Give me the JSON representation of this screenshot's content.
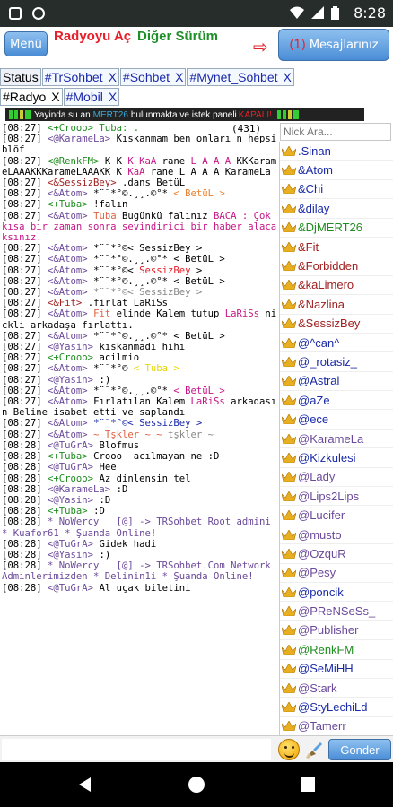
{
  "status_bar": {
    "time": "8:28"
  },
  "header": {
    "menu_label": "Menü",
    "radyo_label": "Radyoyu Aç",
    "diger_label": "Diğer Sürüm",
    "arrow": "⇨",
    "messages_count": "(1)",
    "messages_label": "Mesajlarınız"
  },
  "tabs_row1": [
    {
      "label": "Status",
      "close": "",
      "kind": "status"
    },
    {
      "label": "#TrSohbet",
      "close": "X",
      "kind": "tab"
    },
    {
      "label": "#Sohbet",
      "close": "X",
      "kind": "tab"
    },
    {
      "label": "#Mynet_Sohbet",
      "close": "X",
      "kind": "tab"
    }
  ],
  "tabs_row2": [
    {
      "label": "#Radyo",
      "close": "X",
      "kind": "active"
    },
    {
      "label": "#Mobil",
      "close": "X",
      "kind": "tab"
    }
  ],
  "banner": {
    "pre": "Yayinda su an",
    "dj": "MERT26",
    "mid": "bulunmakta ve istek paneli",
    "state": "KAPALI!"
  },
  "chat": {
    "user_count": "(431)",
    "lines": [
      {
        "parts": [
          [
            "[08:27] ",
            "#000"
          ],
          [
            "<+Crooo> Tuba: .",
            "#1e8c1e"
          ]
        ]
      },
      {
        "parts": [
          [
            "[08:27] ",
            "#000"
          ],
          [
            "<@KarameLa> ",
            "#6b4a9a"
          ],
          [
            "Kıskanmam ben onları n hepsi blöf",
            "#000"
          ]
        ]
      },
      {
        "parts": [
          [
            "[08:27] ",
            "#000"
          ],
          [
            "<@RenkFM> ",
            "#1e8c1e"
          ],
          [
            "K K ",
            "#000"
          ],
          [
            "K ",
            "#c71585"
          ],
          [
            "KaA ",
            "#c71585"
          ],
          [
            "rane ",
            "#000"
          ],
          [
            "L A A A ",
            "#c71585"
          ],
          [
            "KKKarameLAAAKKKarameLAAAKK K ",
            "#000"
          ],
          [
            "KaA ",
            "#c71585"
          ],
          [
            "rane L A A A KarameLa",
            "#000"
          ]
        ]
      },
      {
        "parts": [
          [
            "[08:27] ",
            "#000"
          ],
          [
            "<&SessizBey> ",
            "#a02020"
          ],
          [
            ".dans BetüL",
            "#000"
          ]
        ]
      },
      {
        "parts": [
          [
            "[08:27] ",
            "#000"
          ],
          [
            "<&Atom> ",
            "#6b4a9a"
          ],
          [
            "*¨¨*°©.¸¸.©°* ",
            "#000"
          ],
          [
            "< BetüL >",
            "#e88030"
          ]
        ]
      },
      {
        "parts": [
          [
            "[08:27] ",
            "#000"
          ],
          [
            "<+Tuba> ",
            "#1e8c1e"
          ],
          [
            "!falın",
            "#000"
          ]
        ]
      },
      {
        "parts": [
          [
            "[08:27] ",
            "#000"
          ],
          [
            "<&Atom> ",
            "#6b4a9a"
          ],
          [
            "Tuba ",
            "#e06040"
          ],
          [
            "Bugünkü falınız ",
            "#000"
          ],
          [
            "BACA : Çok kısa bir zaman sonra sevindirici bir haber alacaksınız.",
            "#c71585"
          ]
        ]
      },
      {
        "parts": [
          [
            "[08:27] ",
            "#000"
          ],
          [
            "<&Atom> ",
            "#6b4a9a"
          ],
          [
            "*¨¨*°©< SessizBey >",
            "#000"
          ]
        ]
      },
      {
        "parts": [
          [
            "[08:27] ",
            "#000"
          ],
          [
            "<&Atom> ",
            "#6b4a9a"
          ],
          [
            "*¨¨*°©.¸¸.©°* < BetüL >",
            "#000"
          ]
        ]
      },
      {
        "parts": [
          [
            "[08:27] ",
            "#000"
          ],
          [
            "<&Atom> ",
            "#6b4a9a"
          ],
          [
            "*¨¨*°©< ",
            "#000"
          ],
          [
            "SessizBey",
            "#e6202a"
          ],
          [
            " >",
            "#000"
          ]
        ]
      },
      {
        "parts": [
          [
            "[08:27] ",
            "#000"
          ],
          [
            "<&Atom> ",
            "#6b4a9a"
          ],
          [
            "*¨¨*°©.¸¸.©°* < BetüL >",
            "#000"
          ]
        ]
      },
      {
        "parts": [
          [
            "[08:27] ",
            "#000"
          ],
          [
            "<&Atom> ",
            "#6b4a9a"
          ],
          [
            "*¨¨*°©< SessizBey >",
            "#888"
          ]
        ]
      },
      {
        "parts": [
          [
            "[08:27] ",
            "#000"
          ],
          [
            "<&Fit> ",
            "#a02020"
          ],
          [
            ".firlat LaRiSs",
            "#000"
          ]
        ]
      },
      {
        "parts": [
          [
            "[08:27] ",
            "#000"
          ],
          [
            "<&Atom> ",
            "#6b4a9a"
          ],
          [
            "Fit ",
            "#e06040"
          ],
          [
            "elinde Kalem tutup ",
            "#000"
          ],
          [
            "LaRiSs ",
            "#c71585"
          ],
          [
            "nickli arkadaşa fırlattı.",
            "#000"
          ]
        ]
      },
      {
        "parts": [
          [
            "[08:27] ",
            "#000"
          ],
          [
            "<&Atom> ",
            "#6b4a9a"
          ],
          [
            "*¨¨*°©.¸¸.©°* < BetüL >",
            "#000"
          ]
        ]
      },
      {
        "parts": [
          [
            "[08:27] ",
            "#000"
          ],
          [
            "<@Yasin> ",
            "#6b4a9a"
          ],
          [
            "kıskanmadı hıhı",
            "#000"
          ]
        ]
      },
      {
        "parts": [
          [
            "[08:27] ",
            "#000"
          ],
          [
            "<+Crooo> ",
            "#1e8c1e"
          ],
          [
            "acilmio",
            "#000"
          ]
        ]
      },
      {
        "parts": [
          [
            "[08:27] ",
            "#000"
          ],
          [
            "<&Atom> ",
            "#6b4a9a"
          ],
          [
            "*¨¨*°© ",
            "#000"
          ],
          [
            "< Tuba >",
            "#e6d600"
          ]
        ]
      },
      {
        "parts": [
          [
            "[08:27] ",
            "#000"
          ],
          [
            "<@Yasin> ",
            "#6b4a9a"
          ],
          [
            ":)",
            "#000"
          ]
        ]
      },
      {
        "parts": [
          [
            "[08:27] ",
            "#000"
          ],
          [
            "<&Atom> ",
            "#6b4a9a"
          ],
          [
            "*¨¨*°©.¸¸.©°* ",
            "#000"
          ],
          [
            "< BetüL >",
            "#c71585"
          ]
        ]
      },
      {
        "parts": [
          [
            "[08:27] ",
            "#000"
          ],
          [
            "<&Atom> ",
            "#6b4a9a"
          ],
          [
            "Fırlatılan Kalem ",
            "#000"
          ],
          [
            "LaRiSs ",
            "#c71585"
          ],
          [
            "arkadasın Beline isabet etti ve saplandı",
            "#000"
          ]
        ]
      },
      {
        "parts": [
          [
            "[08:27] ",
            "#000"
          ],
          [
            "<&Atom> ",
            "#6b4a9a"
          ],
          [
            "*¨¨*°©< SessizBey >",
            "#1a2aa8"
          ]
        ]
      },
      {
        "parts": [
          [
            "[08:27] ",
            "#000"
          ],
          [
            "<&Atom> ",
            "#6b4a9a"
          ],
          [
            "~ Tşkler ~ ~ ",
            "#e06040"
          ],
          [
            "tşkler ~",
            "#888"
          ]
        ]
      },
      {
        "parts": [
          [
            "[08:28] ",
            "#000"
          ],
          [
            "<@TuGrA> ",
            "#6b4a9a"
          ],
          [
            "Blofmus",
            "#000"
          ]
        ]
      },
      {
        "parts": [
          [
            "[08:28] ",
            "#000"
          ],
          [
            "<+Tuba> ",
            "#1e8c1e"
          ],
          [
            "Crooo  acılmayan ne :D",
            "#000"
          ]
        ]
      },
      {
        "parts": [
          [
            "[08:28] ",
            "#000"
          ],
          [
            "<@TuGrA> ",
            "#6b4a9a"
          ],
          [
            "Hee",
            "#000"
          ]
        ]
      },
      {
        "parts": [
          [
            "[08:28] ",
            "#000"
          ],
          [
            "<+Crooo> ",
            "#1e8c1e"
          ],
          [
            "Az dinlensin tel",
            "#000"
          ]
        ]
      },
      {
        "parts": [
          [
            "[08:28] ",
            "#000"
          ],
          [
            "<@KarameLa> ",
            "#6b4a9a"
          ],
          [
            ":D",
            "#000"
          ]
        ]
      },
      {
        "parts": [
          [
            "[08:28] ",
            "#000"
          ],
          [
            "<@Yasin> ",
            "#6b4a9a"
          ],
          [
            ":D",
            "#000"
          ]
        ]
      },
      {
        "parts": [
          [
            "[08:28] ",
            "#000"
          ],
          [
            "<+Tuba> ",
            "#1e8c1e"
          ],
          [
            ":D",
            "#000"
          ]
        ]
      },
      {
        "parts": [
          [
            "[08:28] ",
            "#000"
          ],
          [
            "* NoWercy   [@] -> TRSohbet Root admini * Kuafor61 * Şuanda Online!",
            "#6b4a9a"
          ]
        ]
      },
      {
        "parts": [
          [
            "[08:28] ",
            "#000"
          ],
          [
            "<@TuGrA> ",
            "#6b4a9a"
          ],
          [
            "Gidek hadi",
            "#000"
          ]
        ]
      },
      {
        "parts": [
          [
            "[08:28] ",
            "#000"
          ],
          [
            "<@Yasin> ",
            "#6b4a9a"
          ],
          [
            ":)",
            "#000"
          ]
        ]
      },
      {
        "parts": [
          [
            "[08:28] ",
            "#000"
          ],
          [
            "* NoWercy   [@] -> TRSohbet.Com Network Adminlerimizden * Delinin1i * Şuanda Online!",
            "#6b4a9a"
          ]
        ]
      },
      {
        "parts": [
          [
            "[08:28] ",
            "#000"
          ],
          [
            "<@TuGrA> ",
            "#6b4a9a"
          ],
          [
            "Al uçak biletini",
            "#000"
          ]
        ]
      }
    ]
  },
  "nick_search_placeholder": "Nick Ara...",
  "users": [
    {
      "name": ".Sinan",
      "crown": "#e8b020",
      "color": "#1a2aa8"
    },
    {
      "name": "&Atom",
      "crown": "#e8b020",
      "color": "#1a2aa8"
    },
    {
      "name": "&Chi",
      "crown": "#e8b020",
      "color": "#1a2aa8"
    },
    {
      "name": "&dilay",
      "crown": "#e8b020",
      "color": "#1a2aa8"
    },
    {
      "name": "&DjMERT26",
      "crown": "#e8b020",
      "color": "#1e8c1e"
    },
    {
      "name": "&Fit",
      "crown": "#e8b020",
      "color": "#a02020"
    },
    {
      "name": "&Forbidden",
      "crown": "#e8b020",
      "color": "#a02020"
    },
    {
      "name": "&kaLimero",
      "crown": "#e8b020",
      "color": "#a02020"
    },
    {
      "name": "&Nazlina",
      "crown": "#e8b020",
      "color": "#a02020"
    },
    {
      "name": "&SessizBey",
      "crown": "#e8b020",
      "color": "#a02020"
    },
    {
      "name": "@^can^",
      "crown": "#e8b020",
      "color": "#1a2aa8"
    },
    {
      "name": "@_rotasiz_",
      "crown": "#e8b020",
      "color": "#1a2aa8"
    },
    {
      "name": "@Astral",
      "crown": "#e8b020",
      "color": "#1a2aa8"
    },
    {
      "name": "@aZe",
      "crown": "#e8b020",
      "color": "#1a2aa8"
    },
    {
      "name": "@ece",
      "crown": "#e8b020",
      "color": "#1a2aa8"
    },
    {
      "name": "@KarameLa",
      "crown": "#e8b020",
      "color": "#6b4a9a"
    },
    {
      "name": "@Kizkulesi",
      "crown": "#e8b020",
      "color": "#1a2aa8"
    },
    {
      "name": "@Lady",
      "crown": "#e8b020",
      "color": "#6b4a9a"
    },
    {
      "name": "@Lips2Lips",
      "crown": "#e8b020",
      "color": "#6b4a9a"
    },
    {
      "name": "@Lucifer",
      "crown": "#e8b020",
      "color": "#6b4a9a"
    },
    {
      "name": "@musto",
      "crown": "#e8b020",
      "color": "#6b4a9a"
    },
    {
      "name": "@OzquR",
      "crown": "#e8b020",
      "color": "#6b4a9a"
    },
    {
      "name": "@Pesy",
      "crown": "#e8b020",
      "color": "#6b4a9a"
    },
    {
      "name": "@poncik",
      "crown": "#e8b020",
      "color": "#1a2aa8"
    },
    {
      "name": "@PReNSeSs_",
      "crown": "#e8b020",
      "color": "#6b4a9a"
    },
    {
      "name": "@Publisher",
      "crown": "#e8b020",
      "color": "#6b4a9a"
    },
    {
      "name": "@RenkFM",
      "crown": "#e8b020",
      "color": "#1e8c1e"
    },
    {
      "name": "@SeMiHH",
      "crown": "#e8b020",
      "color": "#1a2aa8"
    },
    {
      "name": "@Stark",
      "crown": "#e8b020",
      "color": "#6b4a9a"
    },
    {
      "name": "@StyLechiLd",
      "crown": "#e8b020",
      "color": "#1a2aa8"
    },
    {
      "name": "@Tamerr",
      "crown": "#e8b020",
      "color": "#6b4a9a"
    }
  ],
  "input": {
    "send_label": "Gonder"
  }
}
